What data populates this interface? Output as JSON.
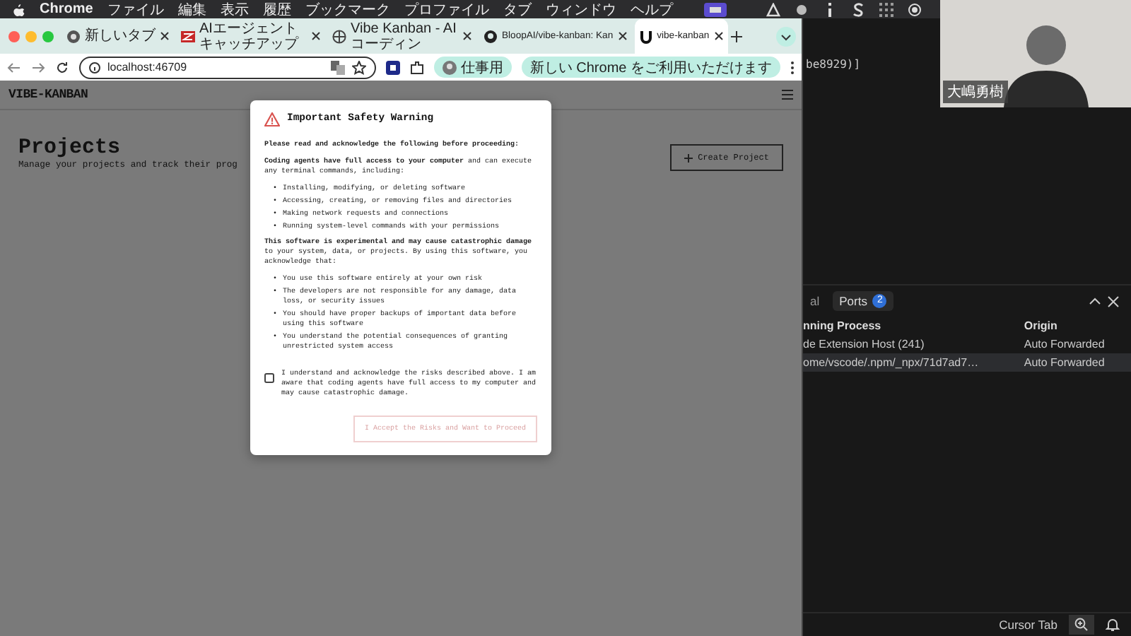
{
  "menu_bar": {
    "app": "Chrome",
    "items": [
      "ファイル",
      "編集",
      "表示",
      "履歴",
      "ブックマーク",
      "プロファイル",
      "タブ",
      "ウィンドウ",
      "ヘルプ"
    ]
  },
  "browser": {
    "tabs": [
      {
        "title": "新しいタブ",
        "kind": "chrome",
        "selected": false
      },
      {
        "title": "AIエージェントキャッチアップ",
        "kind": "brand",
        "selected": false
      },
      {
        "title": "Vibe Kanban - AIコーディン",
        "kind": "web",
        "selected": false
      },
      {
        "title": "BloopAI/vibe-kanban: Kan",
        "kind": "github",
        "selected": false
      },
      {
        "title": "vibe-kanban",
        "kind": "app",
        "selected": true
      }
    ],
    "address": "localhost:46709",
    "profile": "仕事用",
    "update_notice": "新しい Chrome をご利用いただけます"
  },
  "page": {
    "logo": "VIBE-KANBAN",
    "title": "Projects",
    "subtitle": "Manage your projects and track their prog",
    "create_button": "Create Project"
  },
  "modal": {
    "title": "Important Safety Warning",
    "bullet": "•",
    "intro": "Please read and acknowledge the following before proceeding:",
    "access_note": "**Coding agents have full access to your computer** and can execute any terminal commands, including:",
    "access_items": [
      "Installing, modifying, or deleting software",
      "Accessing, creating, or removing files and directories",
      "Making network requests and connections",
      "Running system-level commands with your permissions"
    ],
    "risk_note": "**This software is experimental and may cause catastrophic damage** to your system, data, or projects. By using this software, you acknowledge that:",
    "risk_items": [
      "You use this software entirely at your own risk",
      "The developers are not responsible for any damage, data loss, or security issues",
      "You should have proper backups of important data before using this software",
      "You understand the potential consequences of granting unrestricted system access"
    ],
    "acknowledge": {
      "label": "I understand and acknowledge the risks described above. I am aware that coding agents have full access to my computer and may cause catastrophic damage.",
      "checked": false
    },
    "accept_button": {
      "label": "I Accept the Risks and Want to Proceed",
      "disabled": true
    }
  },
  "editor": {
    "text": "be8929)]"
  },
  "webcam": {
    "name_label": "大嶋勇樹"
  },
  "panel": {
    "tabs": [
      {
        "label": "al",
        "selected": false
      },
      {
        "label": "Ports",
        "badge": "2",
        "selected": true
      }
    ],
    "columns": [
      "nning Process",
      "Origin"
    ],
    "rows": [
      {
        "cells": [
          "de Extension Host (241)",
          "Auto Forwarded"
        ],
        "selected": false
      },
      {
        "cells": [
          "ome/vscode/.npm/_npx/71d7ad7…",
          "Auto Forwarded"
        ],
        "selected": true
      }
    ]
  },
  "status_bar": {
    "item": "Cursor Tab"
  }
}
